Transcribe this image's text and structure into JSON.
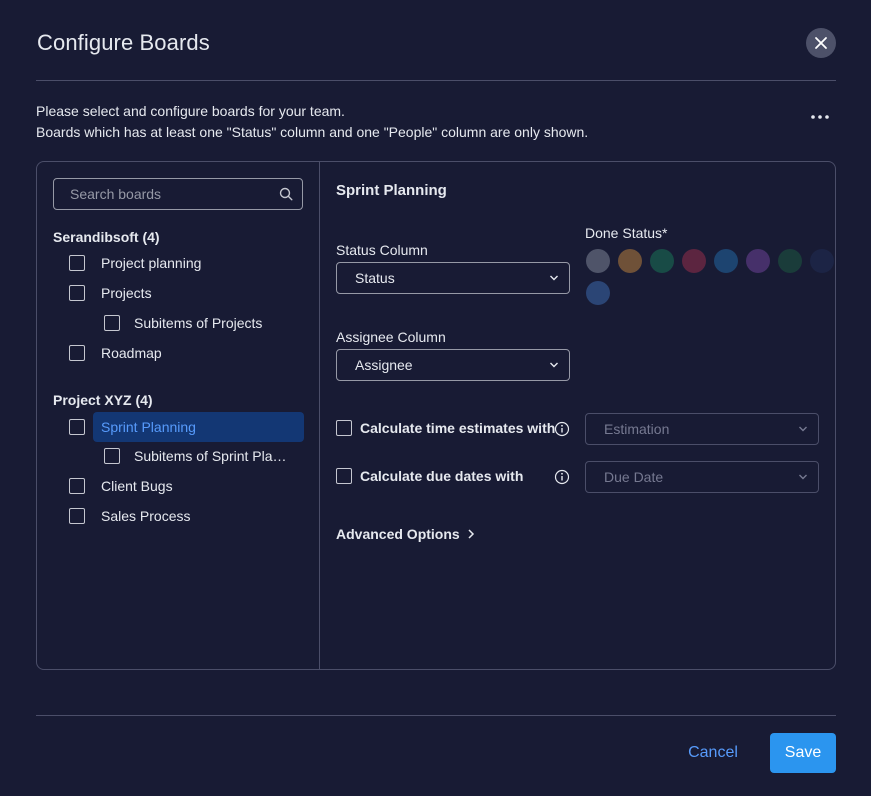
{
  "dialog": {
    "title": "Configure Boards",
    "intro_line1": "Please select and configure boards for your team.",
    "intro_line2": "Boards which has at least one \"Status\" column and one \"People\" column are only shown."
  },
  "search": {
    "placeholder": "Search boards"
  },
  "workspaces": [
    {
      "title": "Serandibsoft (4)",
      "boards": [
        {
          "label": "Project planning"
        },
        {
          "label": "Projects"
        },
        {
          "label": "Subitems of Projects"
        },
        {
          "label": "Roadmap"
        }
      ]
    },
    {
      "title": "Project XYZ (4)",
      "boards": [
        {
          "label": "Sprint Planning",
          "selected": true
        },
        {
          "label": "Subitems of Sprint Planning"
        },
        {
          "label": "Client Bugs"
        },
        {
          "label": "Sales Process"
        }
      ]
    }
  ],
  "config": {
    "board_name": "Sprint Planning",
    "status_column_label": "Status Column",
    "status_column_value": "Status",
    "assignee_column_label": "Assignee Column",
    "assignee_column_value": "Assignee",
    "done_status_label": "Done Status*",
    "done_status_colors": [
      "#4f5469",
      "#6f5138",
      "#184b46",
      "#5c2540",
      "#1d4470",
      "#46306a",
      "#1a3c3a",
      "#1c2445",
      "#2b4575"
    ],
    "time_estimate_label": "Calculate time estimates with",
    "time_estimate_value": "Estimation",
    "due_date_label": "Calculate due dates with",
    "due_date_value": "Due Date",
    "advanced_label": "Advanced Options"
  },
  "footer": {
    "cancel_label": "Cancel",
    "save_label": "Save"
  },
  "colors": {
    "background": "#181b34",
    "accent": "#579bfc",
    "primary_button": "#2b95ef",
    "selected_row": "#133774"
  }
}
